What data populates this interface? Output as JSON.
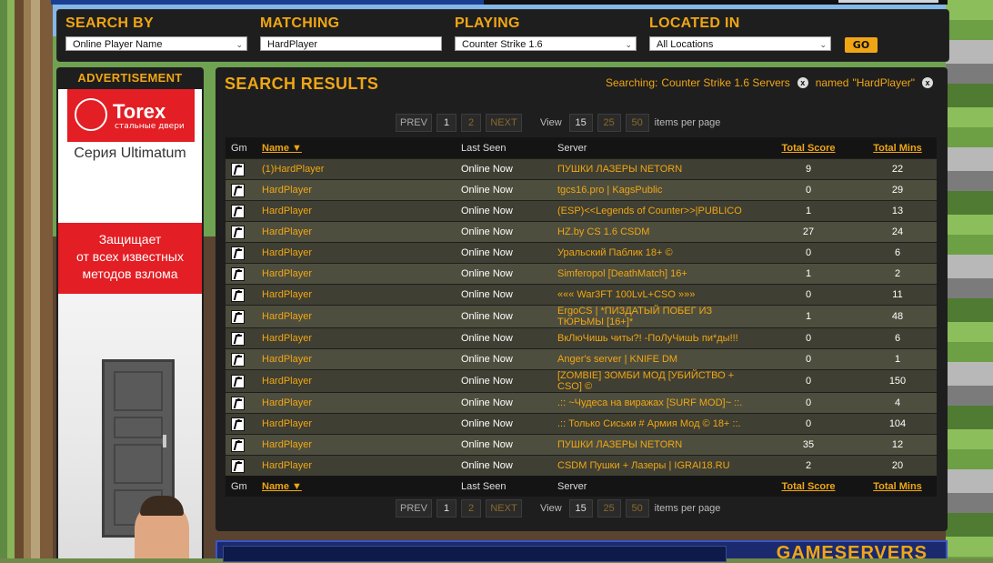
{
  "search": {
    "search_by": {
      "label": "SEARCH BY",
      "value": "Online Player Name"
    },
    "matching": {
      "label": "MATCHING",
      "value": "HardPlayer"
    },
    "playing": {
      "label": "PLAYING",
      "value": "Counter Strike 1.6"
    },
    "located_in": {
      "label": "LOCATED IN",
      "value": "All Locations"
    },
    "go_label": "GO"
  },
  "ad": {
    "title": "ADVERTISEMENT",
    "brand": "Torex",
    "brand_sub": "стальные двери",
    "series": "Серия Ultimatum",
    "tagline_1": "Защищает",
    "tagline_2": "от всех известных",
    "tagline_3": "методов взлома"
  },
  "results": {
    "title": "SEARCH RESULTS",
    "searching_label": "Searching:",
    "searching_game": "Counter Strike 1.6 Servers",
    "named_label": "named",
    "named_value": "\"HardPlayer\"",
    "clear_icon": "x",
    "pager": {
      "prev": "PREV",
      "pages": [
        "1",
        "2"
      ],
      "next": "NEXT",
      "view_label": "View",
      "sizes": [
        "15",
        "25",
        "50"
      ],
      "per_page_label": "items per page"
    },
    "columns": {
      "gm": "Gm",
      "name": "Name ▼",
      "last_seen": "Last Seen",
      "server": "Server",
      "total_score": "Total Score",
      "total_mins": "Total Mins"
    },
    "rows": [
      {
        "name": "(1)HardPlayer",
        "seen": "Online Now",
        "server": "ПУШКИ ЛАЗЕРЫ NETORN",
        "score": "9",
        "mins": "22"
      },
      {
        "name": "HardPlayer",
        "seen": "Online Now",
        "server": "tgcs16.pro | KagsPublic",
        "score": "0",
        "mins": "29"
      },
      {
        "name": "HardPlayer",
        "seen": "Online Now",
        "server": "(ESP)<<Legends of Counter>>|PUBLICO",
        "score": "1",
        "mins": "13"
      },
      {
        "name": "HardPlayer",
        "seen": "Online Now",
        "server": "HZ.by CS 1.6 CSDM",
        "score": "27",
        "mins": "24"
      },
      {
        "name": "HardPlayer",
        "seen": "Online Now",
        "server": "Уральский Паблик 18+ ©",
        "score": "0",
        "mins": "6"
      },
      {
        "name": "HardPlayer",
        "seen": "Online Now",
        "server": "Simferopol [DeathMatch] 16+",
        "score": "1",
        "mins": "2"
      },
      {
        "name": "HardPlayer",
        "seen": "Online Now",
        "server": "««« War3FT 100LvL+CSO »»»",
        "score": "0",
        "mins": "11"
      },
      {
        "name": "HardPlayer",
        "seen": "Online Now",
        "server": "ErgoCS | *ПИЗДАТЫЙ ПОБЕГ ИЗ ТЮРЬМЫ [16+]*",
        "score": "1",
        "mins": "48"
      },
      {
        "name": "HardPlayer",
        "seen": "Online Now",
        "server": "ВкЛюЧишь читы?! -ПоЛуЧишЬ пи*ды!!!",
        "score": "0",
        "mins": "6"
      },
      {
        "name": "HardPlayer",
        "seen": "Online Now",
        "server": "Anger's server | KNIFE DM",
        "score": "0",
        "mins": "1"
      },
      {
        "name": "HardPlayer",
        "seen": "Online Now",
        "server": "[ZOMBIE] ЗОМБИ МОД [УБИЙСТВО + CSO] ©",
        "score": "0",
        "mins": "150"
      },
      {
        "name": "HardPlayer",
        "seen": "Online Now",
        "server": ".:: ~Чудеса на виражах [SURF MOD]~ ::.",
        "score": "0",
        "mins": "4"
      },
      {
        "name": "HardPlayer",
        "seen": "Online Now",
        "server": ".:: Только Сиськи # Армия Мод © 18+ ::.",
        "score": "0",
        "mins": "104"
      },
      {
        "name": "HardPlayer",
        "seen": "Online Now",
        "server": "ПУШКИ ЛАЗЕРЫ NETORN",
        "score": "35",
        "mins": "12"
      },
      {
        "name": "HardPlayer",
        "seen": "Online Now",
        "server": "CSDM Пушки + Лазеры | IGRAI18.RU",
        "score": "2",
        "mins": "20"
      }
    ]
  },
  "banner": {
    "text": "GAMESERVERS"
  }
}
